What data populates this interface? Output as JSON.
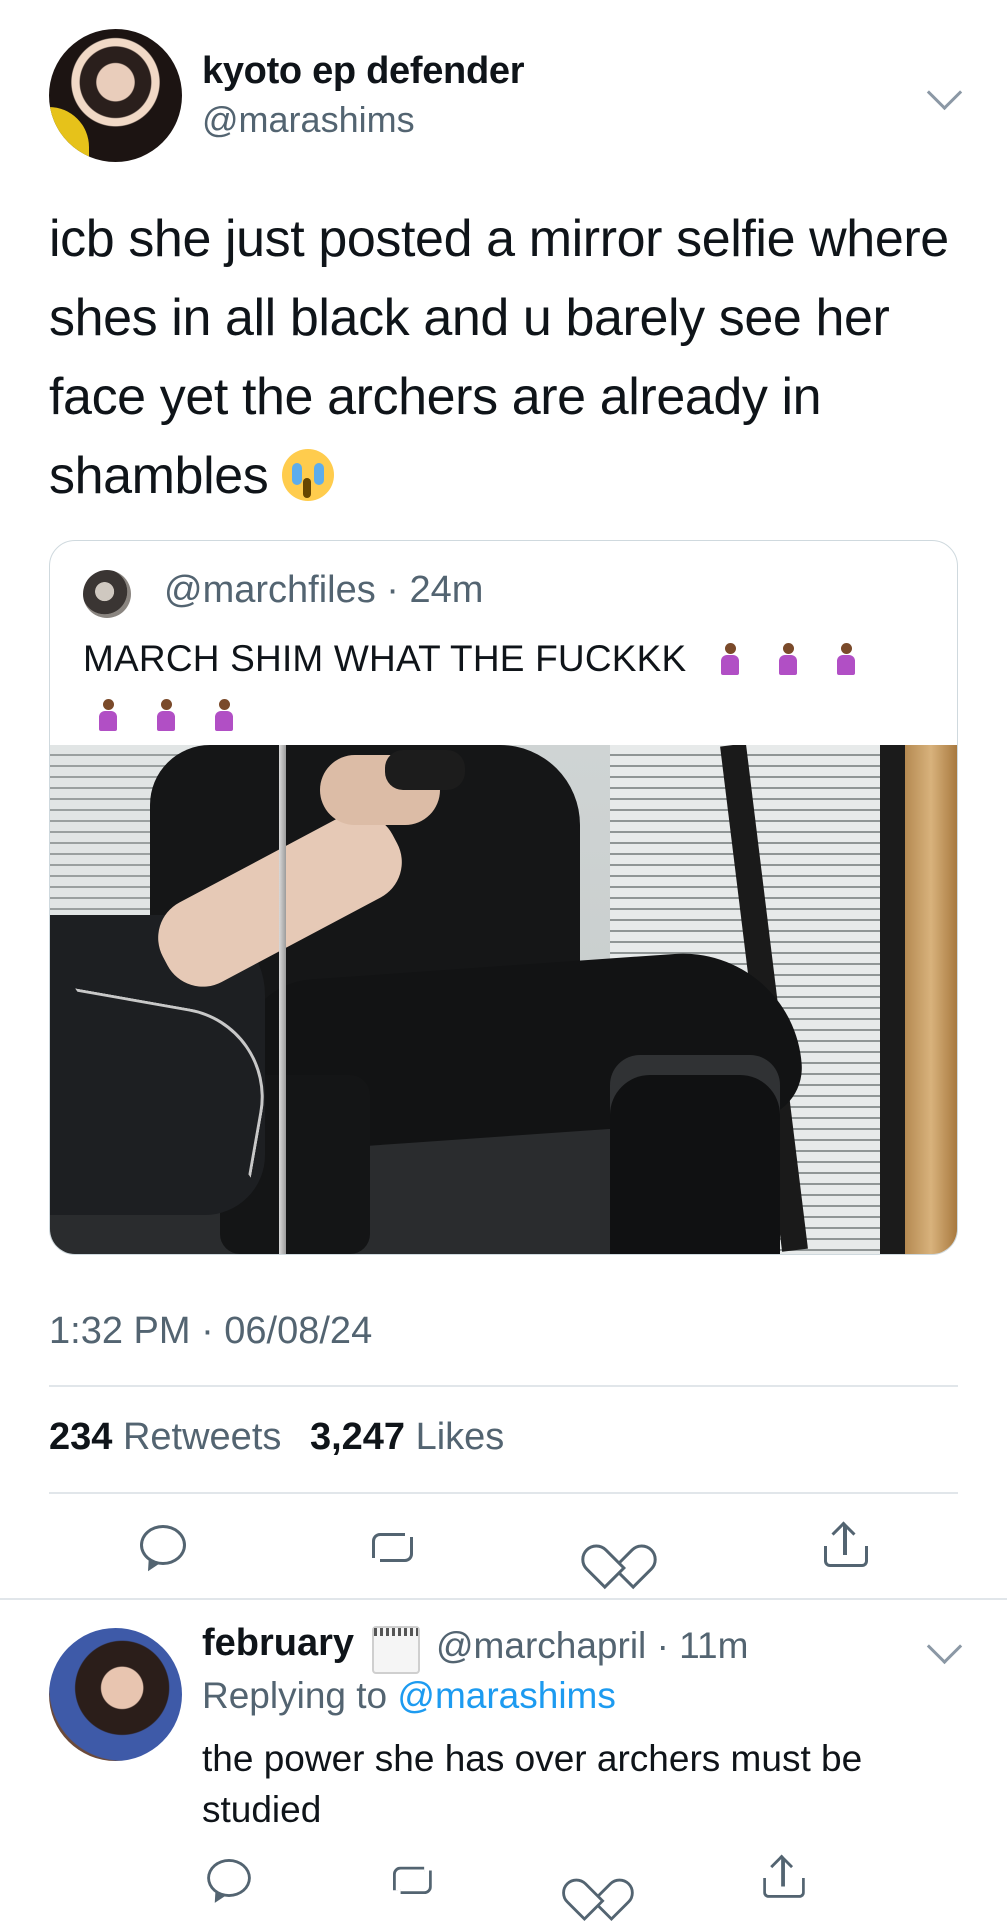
{
  "main_tweet": {
    "display_name": "kyoto ep defender",
    "handle": "@marashims",
    "text": "icb she just posted a mirror selfie where shes in all black and u barely see her face yet the archers are already in shambles",
    "text_emoji": "loudly-crying-face",
    "timestamp": "1:32 PM · 06/08/24",
    "retweets_count": "234",
    "retweets_label": "Retweets",
    "likes_count": "3,247",
    "likes_label": "Likes"
  },
  "quoted_tweet": {
    "handle": "@marchfiles",
    "separator": "·",
    "age": "24m",
    "text": "MARCH SHIM WHAT THE FUCKKK",
    "emoji_name": "person-kneeling",
    "emoji_count": 6
  },
  "actions": {
    "reply_icon": "reply-icon",
    "retweet_icon": "retweet-icon",
    "like_icon": "heart-icon",
    "share_icon": "share-icon"
  },
  "reply": {
    "display_name": "february",
    "name_emoji": "spiral-calendar",
    "handle": "@marchapril",
    "separator": "·",
    "age": "11m",
    "replying_prefix": "Replying to",
    "replying_to": "@marashims",
    "text": "the power she has over archers must be studied"
  },
  "colors": {
    "text": "#0f1419",
    "secondary": "#536471",
    "link": "#1d9bf0",
    "border": "#cfd9de"
  }
}
